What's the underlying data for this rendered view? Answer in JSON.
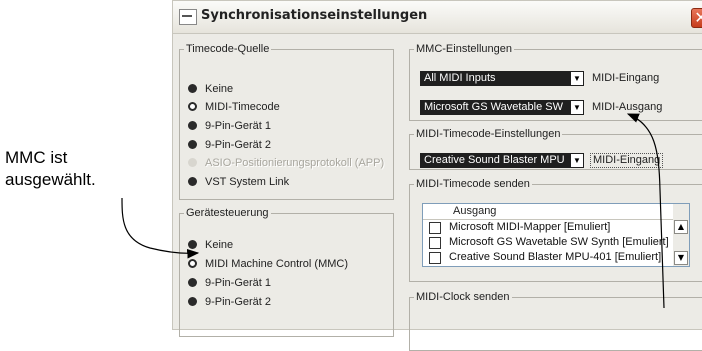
{
  "callout": {
    "line1": "MMC ist",
    "line2": "ausgewählt."
  },
  "window": {
    "title": "Synchronisationseinstellungen",
    "close_glyph": "✕"
  },
  "timecode_source": {
    "legend": "Timecode-Quelle",
    "options": [
      {
        "label": "Keine",
        "state": "unselected"
      },
      {
        "label": "MIDI-Timecode",
        "state": "selected"
      },
      {
        "label": "9-Pin-Gerät 1",
        "state": "unselected"
      },
      {
        "label": "9-Pin-Gerät 2",
        "state": "unselected"
      },
      {
        "label": "ASIO-Positionierungsprotokoll (APP)",
        "state": "disabled"
      },
      {
        "label": "VST System Link",
        "state": "unselected"
      }
    ]
  },
  "device_control": {
    "legend": "Gerätesteuerung",
    "options": [
      {
        "label": "Keine",
        "state": "unselected"
      },
      {
        "label": "MIDI Machine Control (MMC)",
        "state": "selected"
      },
      {
        "label": "9-Pin-Gerät 1",
        "state": "unselected"
      },
      {
        "label": "9-Pin-Gerät 2",
        "state": "unselected"
      }
    ]
  },
  "mmc_settings": {
    "legend": "MMC-Einstellungen",
    "input_value": "All MIDI Inputs",
    "input_label": "MIDI-Eingang",
    "output_value": "Microsoft GS Wavetable SW",
    "output_label": "MIDI-Ausgang"
  },
  "mtc_settings": {
    "legend": "MIDI-Timecode-Einstellungen",
    "input_value": "Creative Sound Blaster MPU",
    "input_label": "MIDI-Eingang"
  },
  "mtc_send": {
    "legend": "MIDI-Timecode senden",
    "column_header": "Ausgang",
    "rows": [
      "Microsoft MIDI-Mapper [Emuliert]",
      "Microsoft GS Wavetable SW Synth [Emuliert]",
      "Creative Sound Blaster MPU-401 [Emuliert]"
    ]
  },
  "clock_send": {
    "legend": "MIDI-Clock senden"
  },
  "icons": {
    "dropdown": "▼",
    "scroll_up": "▲",
    "scroll_down": "▼"
  }
}
